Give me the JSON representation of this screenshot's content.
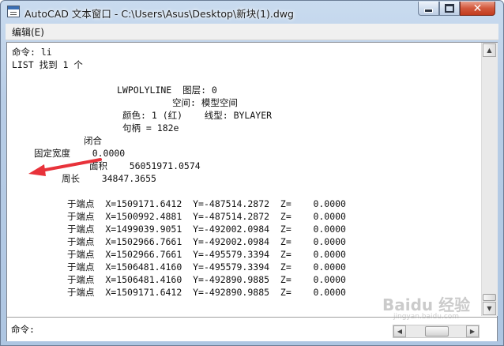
{
  "window": {
    "title": "AutoCAD 文本窗口 - C:\\Users\\Asus\\Desktop\\新块(1).dwg",
    "controls": {
      "minimize": "",
      "maximize": "",
      "close": "✕"
    }
  },
  "menu": {
    "edit": "编辑(E)"
  },
  "output": [
    {
      "text": "命令: li",
      "line": 0,
      "col": 0
    },
    {
      "text": "LIST 找到 1 个",
      "line": 1,
      "col": 0
    },
    {
      "text": "LWPOLYLINE  图层: 0",
      "line": 3,
      "col": 19
    },
    {
      "text": "空间: 模型空间",
      "line": 4,
      "col": 29
    },
    {
      "text": "颜色: 1 (红)    线型: BYLAYER",
      "line": 5,
      "col": 20
    },
    {
      "text": "句柄 = 182e",
      "line": 6,
      "col": 20
    },
    {
      "text": "闭合",
      "line": 7,
      "col": 13
    },
    {
      "text": "固定宽度    0.0000",
      "line": 8,
      "col": 4
    },
    {
      "text": "面积    56051971.0574",
      "line": 9,
      "col": 14
    },
    {
      "text": "周长    34847.3655",
      "line": 10,
      "col": 9
    },
    {
      "text": "于端点  X=1509171.6412  Y=-487514.2872  Z=    0.0000",
      "line": 12,
      "col": 10
    },
    {
      "text": "于端点  X=1500992.4881  Y=-487514.2872  Z=    0.0000",
      "line": 13,
      "col": 10
    },
    {
      "text": "于端点  X=1499039.9051  Y=-492002.0984  Z=    0.0000",
      "line": 14,
      "col": 10
    },
    {
      "text": "于端点  X=1502966.7661  Y=-492002.0984  Z=    0.0000",
      "line": 15,
      "col": 10
    },
    {
      "text": "于端点  X=1502966.7661  Y=-495579.3394  Z=    0.0000",
      "line": 16,
      "col": 10
    },
    {
      "text": "于端点  X=1506481.4160  Y=-495579.3394  Z=    0.0000",
      "line": 17,
      "col": 10
    },
    {
      "text": "于端点  X=1506481.4160  Y=-492890.9885  Z=    0.0000",
      "line": 18,
      "col": 10
    },
    {
      "text": "于端点  X=1509171.6412  Y=-492890.9885  Z=    0.0000",
      "line": 19,
      "col": 10
    }
  ],
  "command_prompt": "命令:",
  "scrollbars": {
    "up": "▲",
    "down": "▼",
    "left": "◀",
    "right": "▶"
  },
  "watermark": {
    "main": "Baidu 经验",
    "sub": "jingyan.baidu.com"
  },
  "annotation_arrow": {
    "color": "#e8323a",
    "points_to": "面积"
  },
  "colors": {
    "close_button": "#c23b1e",
    "title_gradient": "#b8cde6"
  }
}
